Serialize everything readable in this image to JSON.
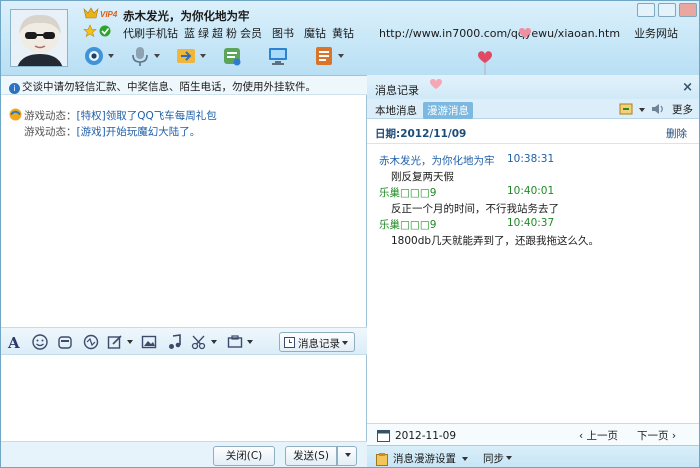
{
  "header": {
    "nickname": "赤木发光，为你化地为牢",
    "vip_badge": "VIP4",
    "links": [
      "代刷手机钻",
      "蓝",
      "绿",
      "超",
      "粉",
      "会员",
      "图书",
      "魔钻",
      "黄钻"
    ],
    "url": "http://www.in7000.com/qqyewu/xiaoan.htm",
    "url_suffix": "业务网站"
  },
  "toolbar": {
    "icons": [
      "video-call-icon",
      "voice-call-icon",
      "send-file-icon",
      "sms-icon",
      "remote-desktop-icon",
      "app-icon"
    ]
  },
  "notice": {
    "text": "交谈中请勿轻信汇款、中奖信息、陌生电话，勿使用外挂软件。"
  },
  "game_messages": [
    {
      "label": "游戏动态：",
      "text": "[特权]领取了QQ飞车每周礼包"
    },
    {
      "label": "游戏动态：",
      "text": "[游戏]开始玩魔幻大陆了。"
    }
  ],
  "format_bar": {
    "record_button": "消息记录"
  },
  "bottom_bar": {
    "close_button": "关闭(C)",
    "send_button": "发送(S)"
  },
  "history": {
    "title": "消息记录",
    "close_glyph": "×",
    "tab_local": "本地消息",
    "tab_roaming": "漫游消息",
    "more": "更多",
    "date_header": "日期:2012/11/09",
    "delete": "删除",
    "entries": [
      {
        "sender": "赤木发光，为你化地为牢",
        "time": "10:38:31",
        "text": "刚反复两天假",
        "color": "#1f5fa8"
      },
      {
        "sender": "乐巢□□□9",
        "time": "10:40:01",
        "text": "反正一个月的时间，不行我站务去了",
        "color": "#1e8b25"
      },
      {
        "sender": "乐巢□□□9",
        "time": "10:40:37",
        "text": "1800db几天就能弄到了，还跟我拖这么久。",
        "color": "#1e8b25"
      }
    ],
    "nav_date": "2012-11-09",
    "prev_page": "上一页",
    "next_page": "下一页",
    "roaming_settings": "消息漫游设置",
    "sync": "同步"
  }
}
